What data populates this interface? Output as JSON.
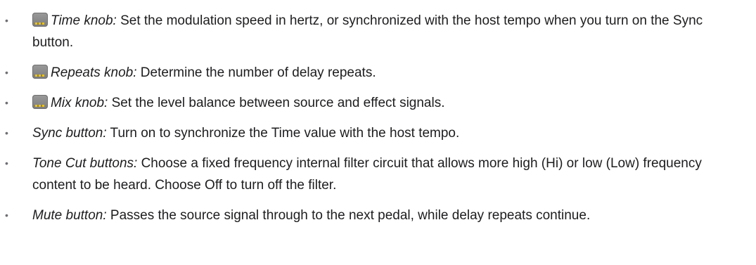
{
  "items": [
    {
      "icon": "knob-parameter-icon",
      "term": "Time knob:",
      "text": " Set the modulation speed in hertz, or synchronized with the host tempo when you turn on the Sync button."
    },
    {
      "icon": "knob-parameter-icon",
      "term": "Repeats knob:",
      "text": " Determine the number of delay repeats."
    },
    {
      "icon": "knob-parameter-icon",
      "term": "Mix knob:",
      "text": " Set the level balance between source and effect signals."
    },
    {
      "term": "Sync button:",
      "text": " Turn on to synchronize the Time value with the host tempo."
    },
    {
      "term": "Tone Cut buttons:",
      "text": " Choose a fixed frequency internal filter circuit that allows more high (Hi) or low (Low) frequency content to be heard. Choose Off to turn off the filter."
    },
    {
      "term": "Mute button:",
      "text": " Passes the source signal through to the next pedal, while delay repeats continue."
    }
  ]
}
